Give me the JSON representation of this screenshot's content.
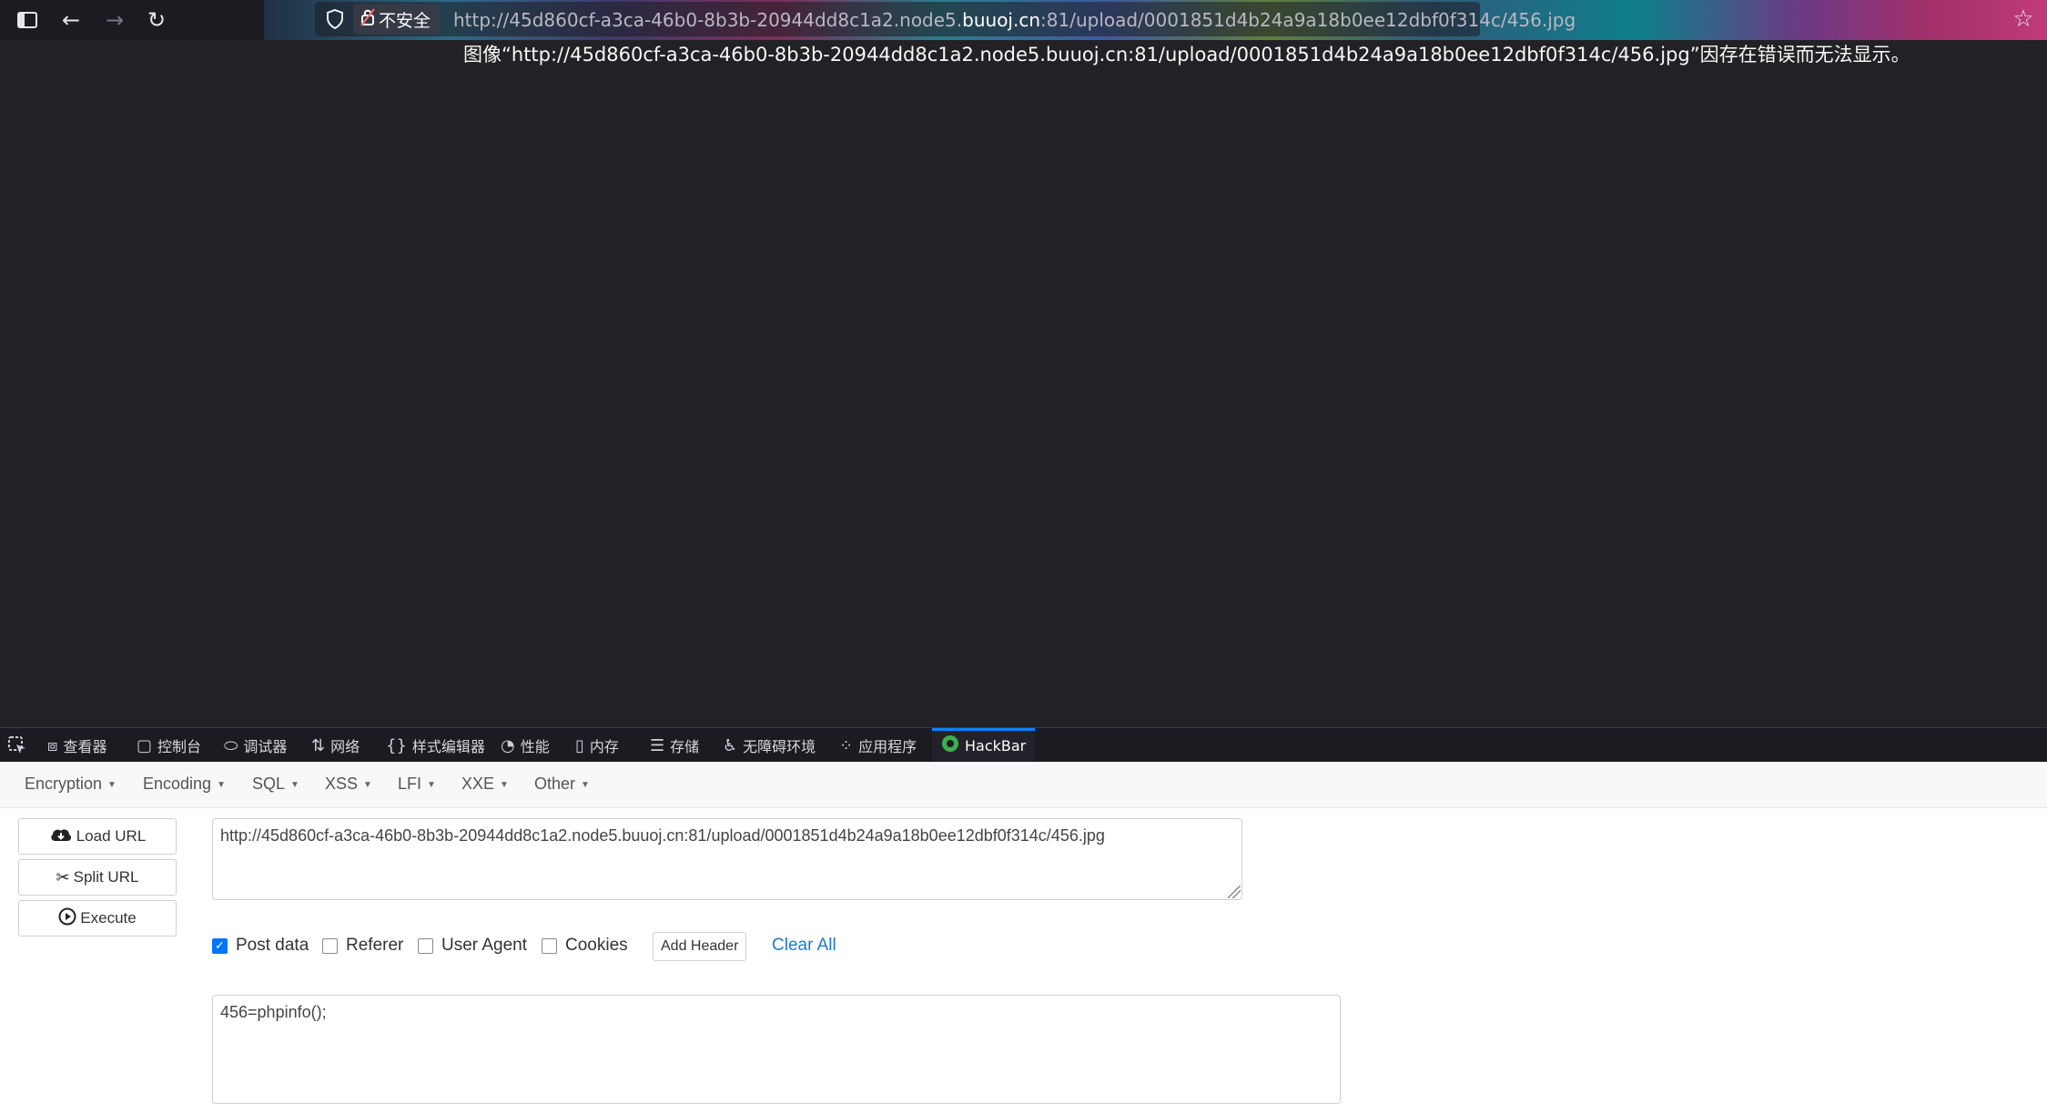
{
  "browser": {
    "url_prefix": "http://45d860cf-a3ca-46b0-8b3b-20944dd8c1a2.node5.",
    "url_domain": "buuoj.cn",
    "url_suffix": ":81/upload/0001851d4b24a9a18b0ee12dbf0f314c/456.jpg",
    "insecure_label": "不安全",
    "icons": [
      "sidebar-icon",
      "back-icon",
      "forward-icon",
      "reload-icon",
      "shield-icon",
      "insecure-lock-icon",
      "bookmark-star-icon"
    ]
  },
  "content": {
    "error_message": "图像“http://45d860cf-a3ca-46b0-8b3b-20944dd8c1a2.node5.buuoj.cn:81/upload/0001851d4b24a9a18b0ee12dbf0f314c/456.jpg”因存在错误而无法显示。",
    "background": "#222226"
  },
  "devtools": {
    "tabs": [
      {
        "label": "查看器",
        "icon": "inspector-icon"
      },
      {
        "label": "控制台",
        "icon": "console-icon"
      },
      {
        "label": "调试器",
        "icon": "debugger-icon"
      },
      {
        "label": "网络",
        "icon": "network-icon"
      },
      {
        "label": "样式编辑器",
        "icon": "style-editor-icon"
      },
      {
        "label": "性能",
        "icon": "performance-icon"
      },
      {
        "label": "内存",
        "icon": "memory-icon"
      },
      {
        "label": "存储",
        "icon": "storage-icon"
      },
      {
        "label": "无障碍环境",
        "icon": "accessibility-icon"
      },
      {
        "label": "应用程序",
        "icon": "application-icon"
      },
      {
        "label": "HackBar",
        "icon": "hackbar-icon",
        "active": true
      }
    ]
  },
  "hackbar": {
    "menu": [
      "Encryption",
      "Encoding",
      "SQL",
      "XSS",
      "LFI",
      "XXE",
      "Other"
    ],
    "buttons": {
      "load_url": "Load URL",
      "split_url": "Split URL",
      "execute": "Execute"
    },
    "url_value": "http://45d860cf-a3ca-46b0-8b3b-20944dd8c1a2.node5.buuoj.cn:81/upload/0001851d4b24a9a18b0ee12dbf0f314c/456.jpg",
    "options": {
      "post_data": {
        "label": "Post data",
        "checked": true
      },
      "referer": {
        "label": "Referer",
        "checked": false
      },
      "user_agent": {
        "label": "User Agent",
        "checked": false
      },
      "cookies": {
        "label": "Cookies",
        "checked": false
      }
    },
    "add_header": "Add Header",
    "clear_all": "Clear All",
    "post_value": "456=phpinfo();",
    "accent_color": "#0075ff",
    "link_color": "#1f7ac6"
  }
}
